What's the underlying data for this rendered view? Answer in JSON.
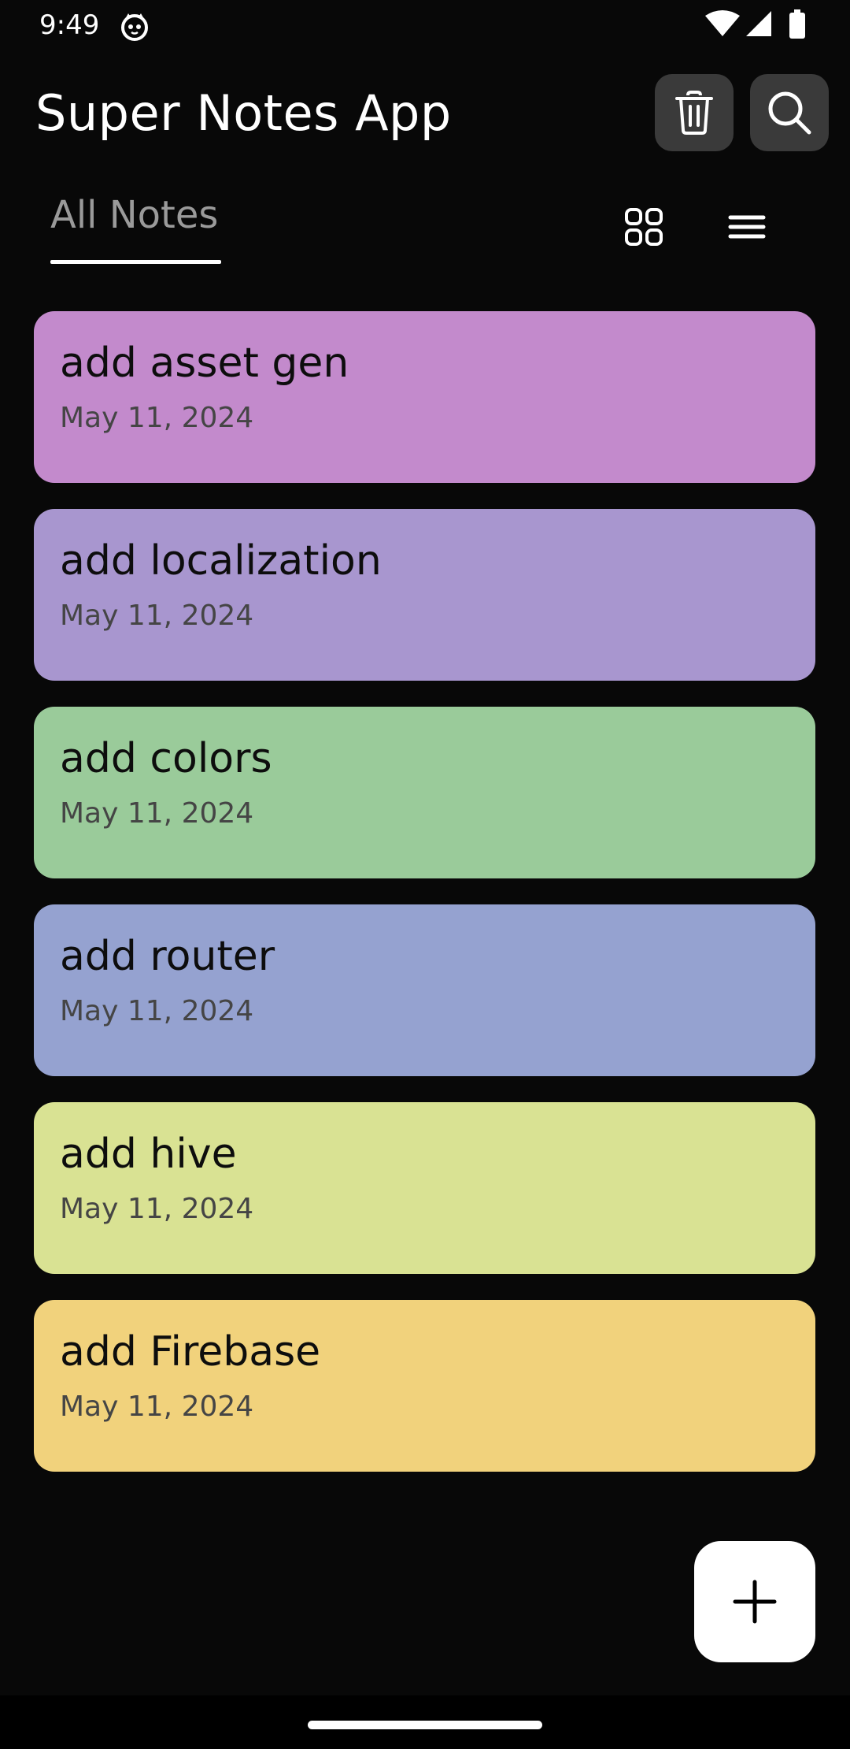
{
  "status_bar": {
    "time": "9:49",
    "app_icon": "cat-face-icon",
    "right_icons": [
      "wifi-icon",
      "signal-icon",
      "battery-icon"
    ]
  },
  "app_bar": {
    "title": "Super Notes App",
    "actions": [
      "trash-icon",
      "search-icon"
    ]
  },
  "tabs": {
    "active_label": "All Notes",
    "view_toggles": [
      "grid-view-icon",
      "list-view-icon"
    ]
  },
  "notes": [
    {
      "title": "add asset gen",
      "date": "May 11, 2024",
      "color": "#C38ACC"
    },
    {
      "title": "add localization",
      "date": "May 11, 2024",
      "color": "#A896CF"
    },
    {
      "title": "add colors",
      "date": "May 11, 2024",
      "color": "#9ACB9A"
    },
    {
      "title": "add router",
      "date": "May 11, 2024",
      "color": "#95A2D0"
    },
    {
      "title": "add hive",
      "date": "May 11, 2024",
      "color": "#D9E293"
    },
    {
      "title": "add Firebase",
      "date": "May 11, 2024",
      "color": "#F1D27C"
    }
  ],
  "fab": {
    "icon": "plus-icon"
  },
  "colors": {
    "background": "#080808",
    "icon_button_bg": "#3A3A3A",
    "tab_text": "#9A9A9A",
    "fab_bg": "#FFFFFF"
  }
}
